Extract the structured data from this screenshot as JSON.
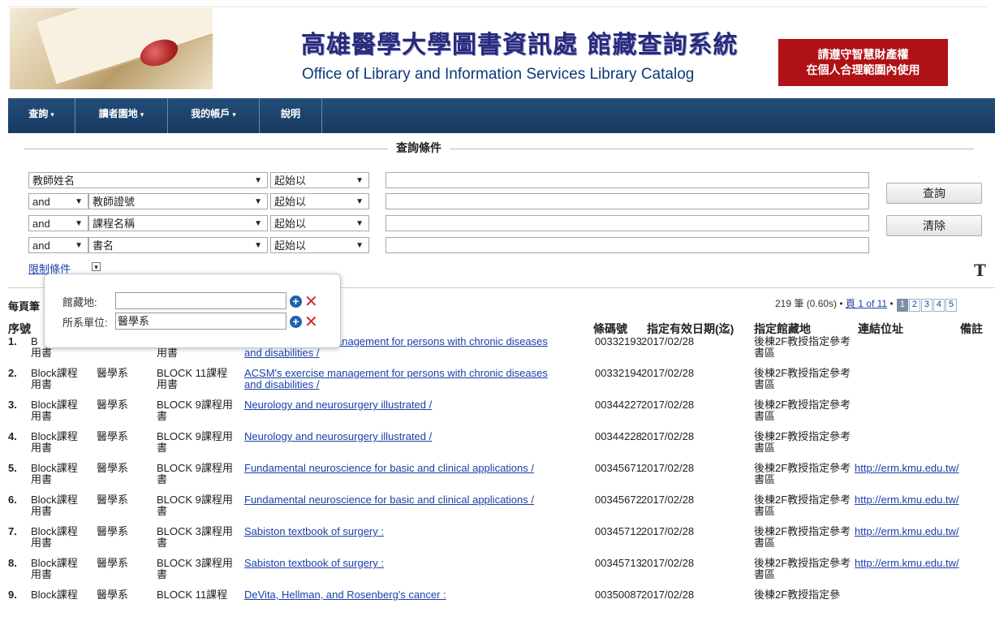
{
  "header": {
    "title_zh": "高雄醫學大學圖書資訊處 館藏查詢系統",
    "title_en": "Office of Library and Information Services  Library Catalog",
    "notice_line1": "請遵守智慧財產權",
    "notice_line2": "在個人合理範圍內使用"
  },
  "nav": {
    "items": [
      {
        "label": "查詢"
      },
      {
        "label": "讀者園地"
      },
      {
        "label": "我的帳戶"
      },
      {
        "label": "說明"
      }
    ]
  },
  "search": {
    "legend": "查詢條件",
    "rows": [
      {
        "op": "",
        "field": "教師姓名",
        "mode": "起始以",
        "value": ""
      },
      {
        "op": "and",
        "field": "教師證號",
        "mode": "起始以",
        "value": ""
      },
      {
        "op": "and",
        "field": "課程名稱",
        "mode": "起始以",
        "value": ""
      },
      {
        "op": "and",
        "field": "書名",
        "mode": "起始以",
        "value": ""
      }
    ],
    "search_btn": "查詢",
    "clear_btn": "清除",
    "limit_label": "限制條件"
  },
  "popup": {
    "location_label": "館藏地:",
    "location_value": "",
    "dept_label": "所系單位:",
    "dept_value": "醫學系"
  },
  "results": {
    "perpage_label": "每頁筆",
    "summary": "219 筆 (0.60s) • ",
    "page_link": "頁 1 of 11",
    "pages": [
      "1",
      "2",
      "3",
      "4",
      "5"
    ],
    "headers": {
      "seq": "序號",
      "barcode": "條碼號",
      "due": "指定有效日期(迄)",
      "location": "指定館藏地",
      "url": "連結位址",
      "note": "備註"
    },
    "rows": [
      {
        "num": "1.",
        "c1": "B",
        "c1b": "用書",
        "c2": "",
        "c3": "",
        "c3b": "用書",
        "title": "ACSM's exercise management for persons with chronic diseases",
        "title2": "and disabilities /",
        "bar": "00332193",
        "date": "2017/02/28",
        "loc": "後棟2F教授指定參考書區",
        "url": ""
      },
      {
        "num": "2.",
        "c1": "Block課程",
        "c1b": "用書",
        "c2": "醫學系",
        "c3": "BLOCK 11課程",
        "c3b": "用書",
        "title": "ACSM's exercise management for persons with chronic diseases",
        "title2": "and disabilities /",
        "bar": "00332194",
        "date": "2017/02/28",
        "loc": "後棟2F教授指定參考書區",
        "url": ""
      },
      {
        "num": "3.",
        "c1": "Block課程",
        "c1b": "用書",
        "c2": "醫學系",
        "c3": "BLOCK 9課程用",
        "c3b": "書",
        "title": "Neurology and neurosurgery illustrated /",
        "title2": "",
        "bar": "00344227",
        "date": "2017/02/28",
        "loc": "後棟2F教授指定參考書區",
        "url": ""
      },
      {
        "num": "4.",
        "c1": "Block課程",
        "c1b": "用書",
        "c2": "醫學系",
        "c3": "BLOCK 9課程用",
        "c3b": "書",
        "title": "Neurology and neurosurgery illustrated /",
        "title2": "",
        "bar": "00344228",
        "date": "2017/02/28",
        "loc": "後棟2F教授指定參考書區",
        "url": ""
      },
      {
        "num": "5.",
        "c1": "Block課程",
        "c1b": "用書",
        "c2": "醫學系",
        "c3": "BLOCK 9課程用",
        "c3b": "書",
        "title": "Fundamental neuroscience for basic and clinical applications /",
        "title2": "",
        "bar": "00345671",
        "date": "2017/02/28",
        "loc": "後棟2F教授指定參考書區",
        "url": "http://erm.kmu.edu.tw/"
      },
      {
        "num": "6.",
        "c1": "Block課程",
        "c1b": "用書",
        "c2": "醫學系",
        "c3": "BLOCK 9課程用",
        "c3b": "書",
        "title": "Fundamental neuroscience for basic and clinical applications /",
        "title2": "",
        "bar": "00345672",
        "date": "2017/02/28",
        "loc": "後棟2F教授指定參考書區",
        "url": "http://erm.kmu.edu.tw/"
      },
      {
        "num": "7.",
        "c1": "Block課程",
        "c1b": "用書",
        "c2": "醫學系",
        "c3": "BLOCK 3課程用",
        "c3b": "書",
        "title": "Sabiston textbook of surgery :",
        "title2": "",
        "bar": "00345712",
        "date": "2017/02/28",
        "loc": "後棟2F教授指定參考書區",
        "url": "http://erm.kmu.edu.tw/"
      },
      {
        "num": "8.",
        "c1": "Block課程",
        "c1b": "用書",
        "c2": "醫學系",
        "c3": "BLOCK 3課程用",
        "c3b": "書",
        "title": "Sabiston textbook of surgery :",
        "title2": "",
        "bar": "00345713",
        "date": "2017/02/28",
        "loc": "後棟2F教授指定參考書區",
        "url": "http://erm.kmu.edu.tw/"
      },
      {
        "num": "9.",
        "c1": "Block課程",
        "c1b": "",
        "c2": "醫學系",
        "c3": "BLOCK 11課程",
        "c3b": "",
        "title": "DeVita, Hellman, and Rosenberg's cancer :",
        "title2": "",
        "bar": "00350087",
        "date": "2017/02/28",
        "loc": "後棟2F教授指定參",
        "url": ""
      }
    ]
  }
}
